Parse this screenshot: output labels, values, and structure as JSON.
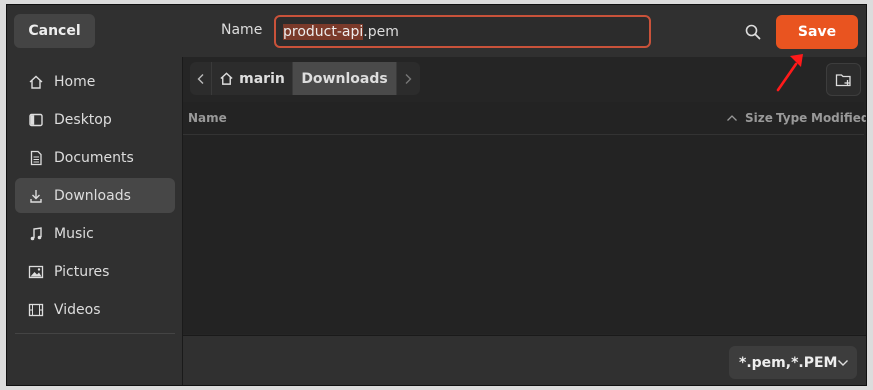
{
  "header": {
    "cancel_label": "Cancel",
    "name_label": "Name",
    "filename_selected": "product-api",
    "filename_ext": ".pem",
    "save_label": "Save"
  },
  "sidebar": {
    "items": [
      {
        "label": "Home",
        "icon": "home-icon"
      },
      {
        "label": "Desktop",
        "icon": "desktop-icon"
      },
      {
        "label": "Documents",
        "icon": "documents-icon"
      },
      {
        "label": "Downloads",
        "icon": "downloads-icon",
        "active": true
      },
      {
        "label": "Music",
        "icon": "music-icon"
      },
      {
        "label": "Pictures",
        "icon": "pictures-icon"
      },
      {
        "label": "Videos",
        "icon": "videos-icon"
      }
    ]
  },
  "pathbar": {
    "home_label": "marin",
    "current_label": "Downloads"
  },
  "filelist": {
    "columns": [
      "Name",
      "Size",
      "Type",
      "Modified"
    ]
  },
  "footer": {
    "filter_label": "*.pem,*.PEM"
  },
  "colors": {
    "accent": "#e95420",
    "annotation_arrow": "#ff0000"
  }
}
